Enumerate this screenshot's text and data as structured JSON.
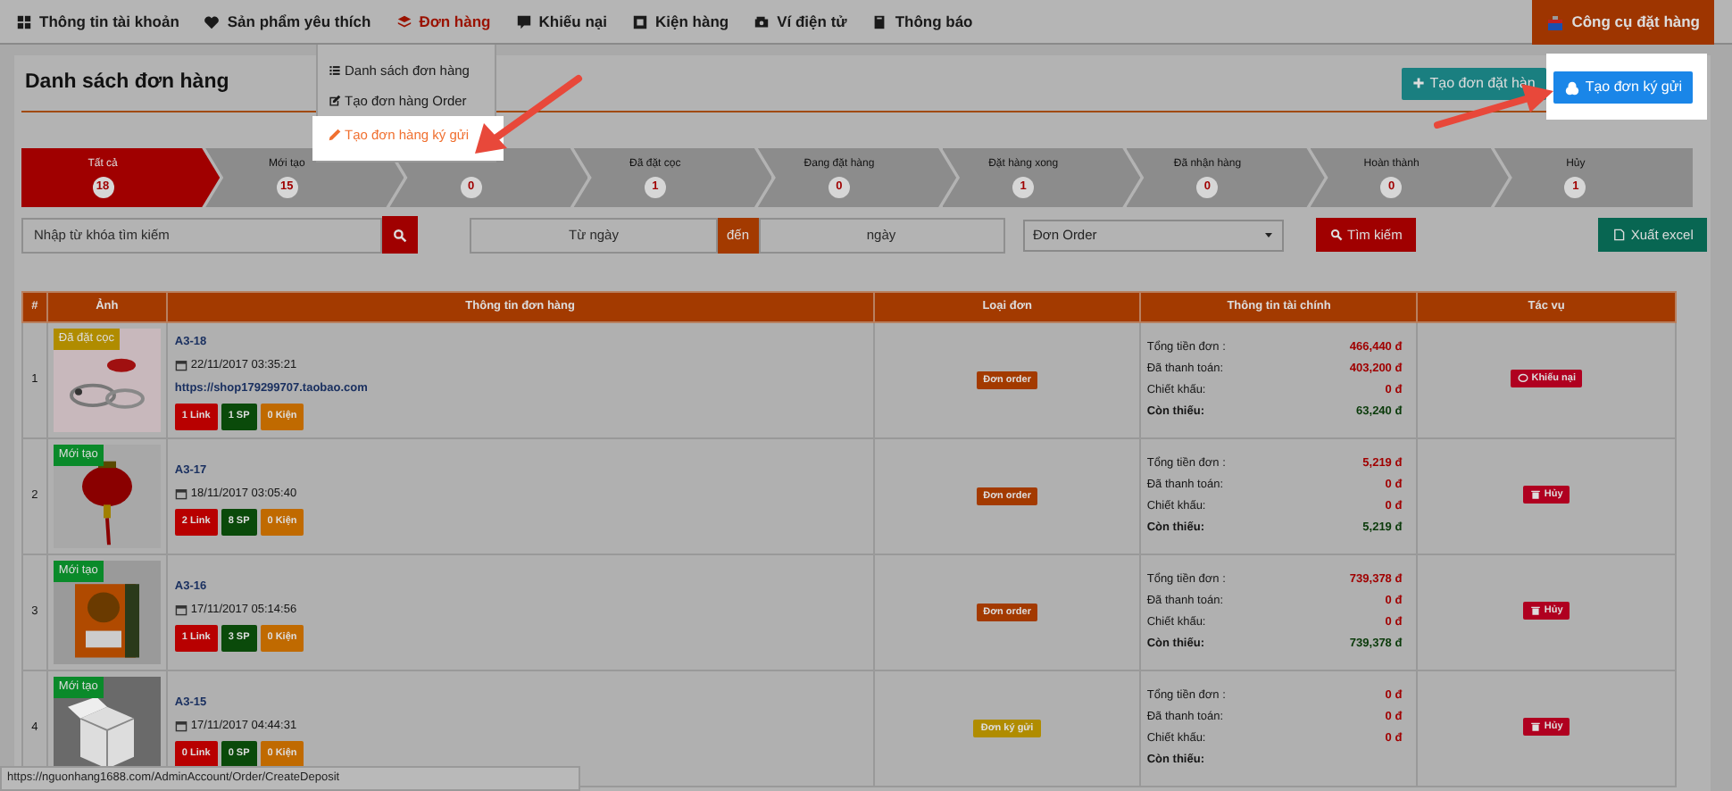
{
  "nav": {
    "items": [
      {
        "label": "Thông tin tài khoản",
        "selected": false
      },
      {
        "label": "Sản phẩm yêu thích",
        "selected": false
      },
      {
        "label": "Đơn hàng",
        "selected": true
      },
      {
        "label": "Khiếu nại",
        "selected": false
      },
      {
        "label": "Kiện hàng",
        "selected": false
      },
      {
        "label": "Ví điện tử",
        "selected": false
      },
      {
        "label": "Thông báo",
        "selected": false
      }
    ],
    "tool": "Công cụ đặt hàng"
  },
  "dropdown": {
    "items": [
      {
        "label": "Danh sách đơn hàng",
        "highlighted": false
      },
      {
        "label": "Tạo đơn hàng Order",
        "highlighted": false
      },
      {
        "label": "Tạo đơn hàng ký gửi",
        "highlighted": true
      }
    ]
  },
  "page": {
    "title": "Danh sách đơn hàng",
    "buttons": [
      {
        "label": "Tạo đơn đặt hàn",
        "kind": "add",
        "highlighted": false
      },
      {
        "label": "Tạo đơn ký gửi",
        "kind": "deposit",
        "highlighted": true
      }
    ]
  },
  "steps": [
    {
      "label": "Tất cả",
      "count": "18",
      "selected": true
    },
    {
      "label": "Mới tạo",
      "count": "15",
      "selected": false
    },
    {
      "count": "0",
      "selected": false
    },
    {
      "label": "Đã đặt cọc",
      "count": "1",
      "selected": false
    },
    {
      "label": "Đang đặt hàng",
      "count": "0",
      "selected": false
    },
    {
      "label": "Đặt hàng xong",
      "count": "1",
      "selected": false
    },
    {
      "label": "Đã nhận hàng",
      "count": "0",
      "selected": false
    },
    {
      "label": "Hoàn thành",
      "count": "0",
      "selected": false
    },
    {
      "label": "Hủy",
      "count": "1",
      "selected": false
    }
  ],
  "filters": {
    "search_placeholder": "Nhập từ khóa tìm kiếm",
    "from_placeholder": "Từ ngày",
    "to_label": "đến",
    "to_placeholder": "ngày",
    "order_type": "Đơn Order",
    "search_button": "Tìm kiếm",
    "export_button": "Xuất excel"
  },
  "table": {
    "columns": [
      "#",
      "Ảnh",
      "Thông tin đơn hàng",
      "Loại đơn",
      "Thông tin tài chính",
      "Tác vụ"
    ],
    "rows": [
      {
        "index": "1",
        "tag": {
          "text": "Đã đặt cọc",
          "color": "#b08c00"
        },
        "code": "A3-18",
        "date": "22/11/2017 03:35:21",
        "link": "https://shop179299707.taobao.com",
        "counts": [
          "1 Link",
          "1 SP",
          "0 Kiện"
        ],
        "type": {
          "text": "Đơn order",
          "kind": "order"
        },
        "finance": [
          {
            "label": "Tổng tiền đơn :",
            "value": "466,440 đ"
          },
          {
            "label": "Đã thanh toán:",
            "value": "403,200 đ"
          },
          {
            "label": "Chiết khấu:",
            "value": "0 đ"
          },
          {
            "label": "Còn thiếu:",
            "value": "63,240 đ"
          }
        ],
        "action": {
          "text": "Khiếu nại",
          "kind": "complain"
        }
      },
      {
        "index": "2",
        "tag": {
          "text": "Mới tạo",
          "color": "#0a8a2a"
        },
        "code": "A3-17",
        "date": "18/11/2017 03:05:40",
        "counts": [
          "2 Link",
          "8 SP",
          "0 Kiện"
        ],
        "type": {
          "text": "Đơn order",
          "kind": "order"
        },
        "finance": [
          {
            "label": "Tổng tiền đơn :",
            "value": "5,219 đ"
          },
          {
            "label": "Đã thanh toán:",
            "value": "0 đ"
          },
          {
            "label": "Chiết khấu:",
            "value": "0 đ"
          },
          {
            "label": "Còn thiếu:",
            "value": "5,219 đ"
          }
        ],
        "action": {
          "text": "Hủy",
          "kind": "cancel"
        }
      },
      {
        "index": "3",
        "tag": {
          "text": "Mới tạo",
          "color": "#0a8a2a"
        },
        "code": "A3-16",
        "date": "17/11/2017 05:14:56",
        "counts": [
          "1 Link",
          "3 SP",
          "0 Kiện"
        ],
        "type": {
          "text": "Đơn order",
          "kind": "order"
        },
        "finance": [
          {
            "label": "Tổng tiền đơn :",
            "value": "739,378 đ"
          },
          {
            "label": "Đã thanh toán:",
            "value": "0 đ"
          },
          {
            "label": "Chiết khấu:",
            "value": "0 đ"
          },
          {
            "label": "Còn thiếu:",
            "value": "739,378 đ"
          }
        ],
        "action": {
          "text": "Hủy",
          "kind": "cancel"
        }
      },
      {
        "index": "4",
        "tag": {
          "text": "Mới tạo",
          "color": "#0a8a2a"
        },
        "code": "A3-15",
        "date": "17/11/2017 04:44:31",
        "counts": [
          "0 Link",
          "0 SP",
          "0 Kiện"
        ],
        "type": {
          "text": "Đơn ký gửi",
          "kind": "deposit"
        },
        "finance": [
          {
            "label": "Tổng tiền đơn :",
            "value": "0 đ"
          },
          {
            "label": "Đã thanh toán:",
            "value": "0 đ"
          },
          {
            "label": "Chiết khấu:",
            "value": "0 đ"
          },
          {
            "label": "Còn thiếu:"
          }
        ],
        "action": {
          "text": "Hủy",
          "kind": "cancel"
        }
      }
    ]
  },
  "status_bar": "https://nguonhang1688.com/AdminAccount/Order/CreateDeposit"
}
